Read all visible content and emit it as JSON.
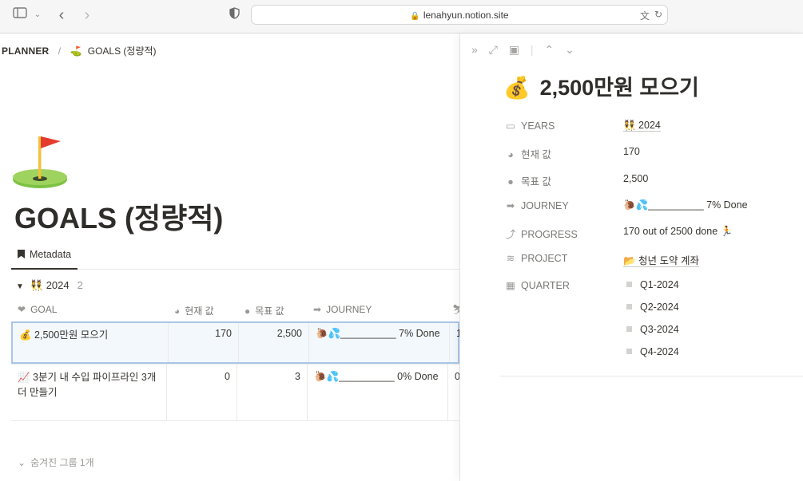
{
  "browser": {
    "url": "lenahyun.notion.site",
    "icons": [
      "sidebar-icon",
      "chevron-down-icon",
      "back-icon",
      "forward-icon",
      "shield-icon",
      "lock-icon",
      "translate-icon",
      "reload-icon"
    ]
  },
  "breadcrumb": {
    "root": "PLANNER",
    "separator": "/",
    "page_emoji": "⛳",
    "page": "GOALS (정량적)"
  },
  "page": {
    "emoji": "⛳",
    "title": "GOALS (정량적)"
  },
  "tabs": [
    {
      "label": "Metadata",
      "icon": "bookmark-icon"
    }
  ],
  "group": {
    "label": "👯 2024",
    "count": "2"
  },
  "table": {
    "columns": [
      {
        "label": "GOAL",
        "icon": "heart-icon"
      },
      {
        "label": "현재 값",
        "icon": "pie-icon"
      },
      {
        "label": "목표 값",
        "icon": "circle-icon"
      },
      {
        "label": "JOURNEY",
        "icon": "arrow-icon"
      }
    ],
    "rows": [
      {
        "name": "💰 2,500만원 모으기",
        "current": "170",
        "target": "2,500",
        "journey": "🐌💦__________ 7% Done",
        "extra": "1"
      },
      {
        "name": "📈 3분기 내 수입 파이프라인 3개 더 만들기",
        "current": "0",
        "target": "3",
        "journey": "🐌💦__________ 0% Done",
        "extra": "0"
      }
    ]
  },
  "hidden_groups": "숨겨진 그룹 1개",
  "panel": {
    "title_emoji": "💰",
    "title": "2,500만원 모으기",
    "properties": {
      "years": {
        "label": "YEARS",
        "value": "👯 2024"
      },
      "current": {
        "label": "현재 값",
        "value": "170"
      },
      "target": {
        "label": "목표 값",
        "value": "2,500"
      },
      "journey": {
        "label": "JOURNEY",
        "value": "🐌💦__________ 7% Done"
      },
      "progress": {
        "label": "PROGRESS",
        "value": "170 out of  2500 done 🏃"
      },
      "project": {
        "label": "PROJECT",
        "value": "📂 청년 도약 계좌"
      },
      "quarter": {
        "label": "QUARTER",
        "values": [
          "Q1-2024",
          "Q2-2024",
          "Q3-2024",
          "Q4-2024"
        ]
      }
    }
  }
}
